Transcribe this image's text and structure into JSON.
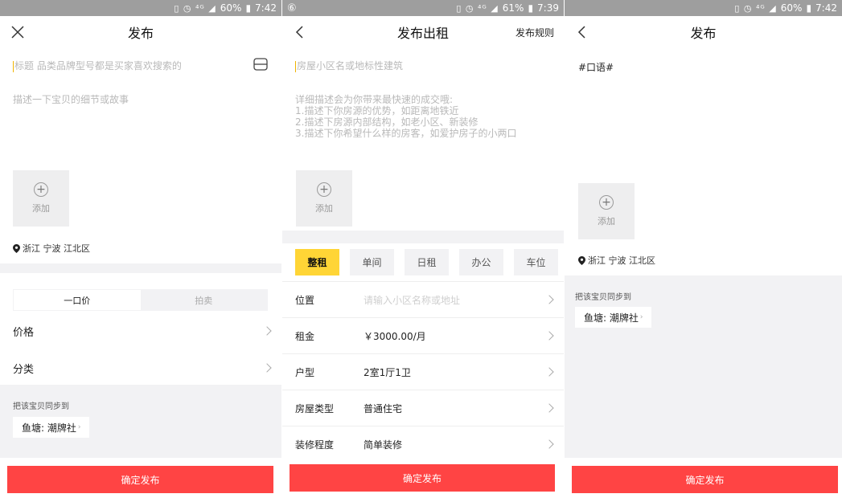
{
  "screens": [
    {
      "status": {
        "left": "",
        "battery": "60%",
        "time": "7:42"
      },
      "nav": {
        "title": "发布",
        "left_icon": "close-icon"
      },
      "title_placeholder": "标题 品类品牌型号都是买家喜欢搜索的",
      "desc_placeholder": "描述一下宝贝的细节或故事",
      "add_label": "添加",
      "location": "浙江 宁波 江北区",
      "price_tabs": [
        "一口价",
        "拍卖"
      ],
      "rows": [
        {
          "label": "价格"
        },
        {
          "label": "分类"
        }
      ],
      "sync_label": "把该宝贝同步到",
      "sync_chip": "鱼塘: 潮牌社",
      "publish": "确定发布"
    },
    {
      "status": {
        "left": "⑥",
        "battery": "61%",
        "time": "7:39"
      },
      "nav": {
        "title": "发布出租",
        "right": "发布规则",
        "left_icon": "back-icon"
      },
      "title_placeholder": "房屋小区名或地标性建筑",
      "desc_lines": [
        "详细描述会为你带来最快速的成交哦:",
        "1.描述下你房源的优势，如距离地铁近",
        "2.描述下房源内部结构，如老小区、新装修",
        "3.描述下你希望什么样的房客，如爱护房子的小两口"
      ],
      "add_label": "添加",
      "types": [
        "整租",
        "单间",
        "日租",
        "办公",
        "车位"
      ],
      "fields": [
        {
          "label": "位置",
          "value": "请输入小区名称或地址",
          "placeholder": true
        },
        {
          "label": "租金",
          "value": "￥3000.00/月",
          "placeholder": false
        },
        {
          "label": "户型",
          "value": "2室1厅1卫",
          "placeholder": false
        },
        {
          "label": "房屋类型",
          "value": "普通住宅",
          "placeholder": false
        },
        {
          "label": "装修程度",
          "value": "简单装修",
          "placeholder": false
        }
      ],
      "publish": "确定发布"
    },
    {
      "status": {
        "left": "",
        "battery": "60%",
        "time": "7:42"
      },
      "nav": {
        "title": "发布",
        "left_icon": "back-icon"
      },
      "title_value": "#口语#",
      "add_label": "添加",
      "location": "浙江 宁波 江北区",
      "sync_label": "把该宝贝同步到",
      "sync_chip": "鱼塘: 潮牌社",
      "publish": "确定发布"
    }
  ],
  "colors": {
    "accent": "#ff4444",
    "active_tab": "#ffd536",
    "band": "#f2f2f4",
    "status": "#9e9e9e"
  }
}
